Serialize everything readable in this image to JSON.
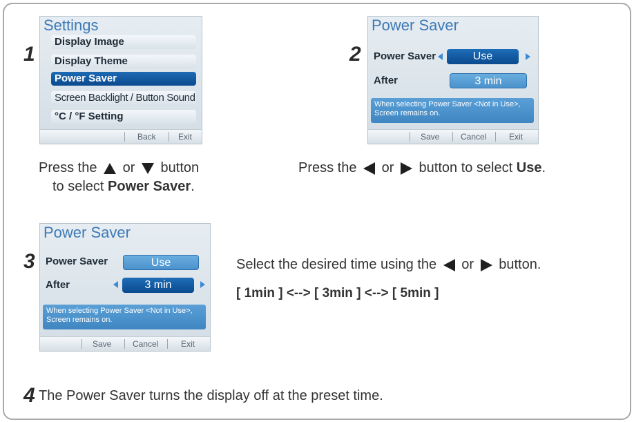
{
  "step1": {
    "number": "1",
    "screen": {
      "title": "Settings",
      "items": [
        "Display Image",
        "Display Theme",
        "Power Saver",
        "Screen Backlight / Button Sound",
        "°C / °F Setting"
      ],
      "selected_index": 2,
      "bottom": {
        "back": "Back",
        "exit": "Exit"
      }
    },
    "caption": {
      "line1_pre": "Press the",
      "line1_mid": "or",
      "line1_post": "button",
      "line2_pre": "to select",
      "line2_bold": "Power Saver",
      "line2_end": "."
    }
  },
  "step2": {
    "number": "2",
    "screen": {
      "title": "Power Saver",
      "row1_label": "Power Saver",
      "row1_value": "Use",
      "row2_label": "After",
      "row2_value": "3 min",
      "note": "When selecting Power Saver <Not in Use>, Screen remains on.",
      "bottom": {
        "save": "Save",
        "cancel": "Cancel",
        "exit": "Exit"
      }
    },
    "caption": {
      "pre": "Press the",
      "mid": "or",
      "post": "button to select",
      "bold": "Use",
      "end": "."
    }
  },
  "step3": {
    "number": "3",
    "screen": {
      "title": "Power Saver",
      "row1_label": "Power Saver",
      "row1_value": "Use",
      "row2_label": "After",
      "row2_value": "3 min",
      "note": "When selecting Power Saver <Not in Use>, Screen remains on.",
      "bottom": {
        "save": "Save",
        "cancel": "Cancel",
        "exit": "Exit"
      }
    },
    "caption": {
      "pre": "Select the desired time using the",
      "mid": "or",
      "post": "button."
    },
    "options": "[ 1min ] <--> [ 3min ] <--> [ 5min ]"
  },
  "step4": {
    "number": "4",
    "text": "The Power Saver turns the display off at the preset time."
  },
  "colors": {
    "accent": "#0b4a8e",
    "title_blue": "#3d79b6",
    "note_blue": "#4b92cc"
  }
}
